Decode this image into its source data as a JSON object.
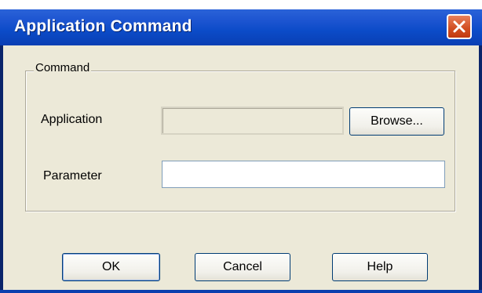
{
  "window": {
    "title": "Application Command",
    "close_icon": "close-icon"
  },
  "group": {
    "legend": "Command"
  },
  "fields": {
    "application": {
      "label": "Application",
      "value": "",
      "disabled": true
    },
    "parameter": {
      "label": "Parameter",
      "value": ""
    }
  },
  "buttons": {
    "browse": "Browse...",
    "ok": "OK",
    "cancel": "Cancel",
    "help": "Help"
  },
  "colors": {
    "titlebar": "#0a3fb3",
    "dialog_bg": "#ece9d8",
    "close_button": "#d14d20"
  }
}
